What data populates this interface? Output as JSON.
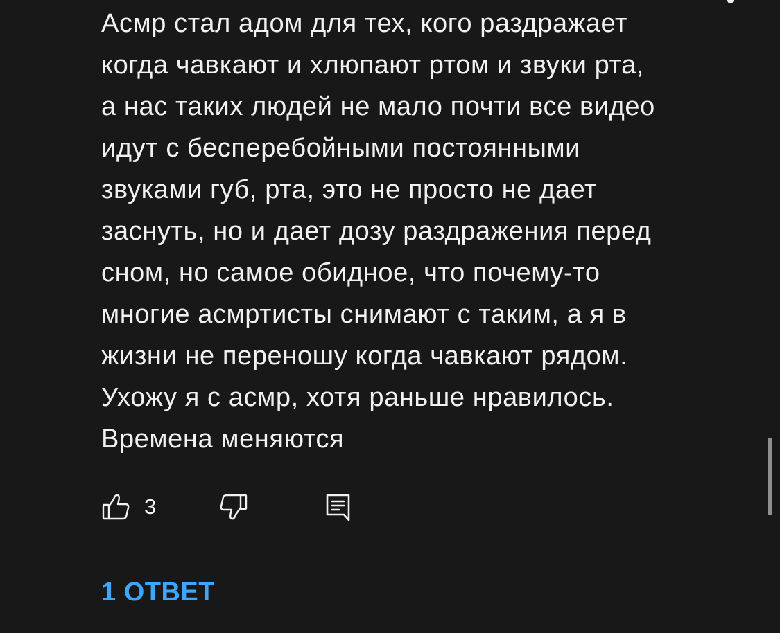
{
  "comment": {
    "lines": [
      "Асмр стал адом для тех, кого раздражает",
      "когда чавкают и хлюпают ртом и звуки рта,",
      "а нас таких людей не мало почти все видео",
      "идут с бесперебойными постоянными",
      "звуками губ, рта, это не просто не дает",
      "заснуть, но и дает дозу раздражения перед",
      "сном, но самое обидное, что почему-то",
      "многие асмртисты снимают с таким, а я в",
      "жизни не переношу когда чавкают рядом.",
      "Ухожу я с асмр, хотя раньше нравилось.",
      "Времена меняются"
    ],
    "like_count": "3",
    "replies_label": "1 ОТВЕТ"
  },
  "icons": {
    "more": "more-vert-icon",
    "like": "thumb-up-icon",
    "dislike": "thumb-down-icon",
    "reply": "reply-comment-icon"
  },
  "colors": {
    "background": "#181818",
    "text": "#f1f1f1",
    "accent": "#3ea6ff",
    "scrollbar": "#8f8f8f"
  }
}
